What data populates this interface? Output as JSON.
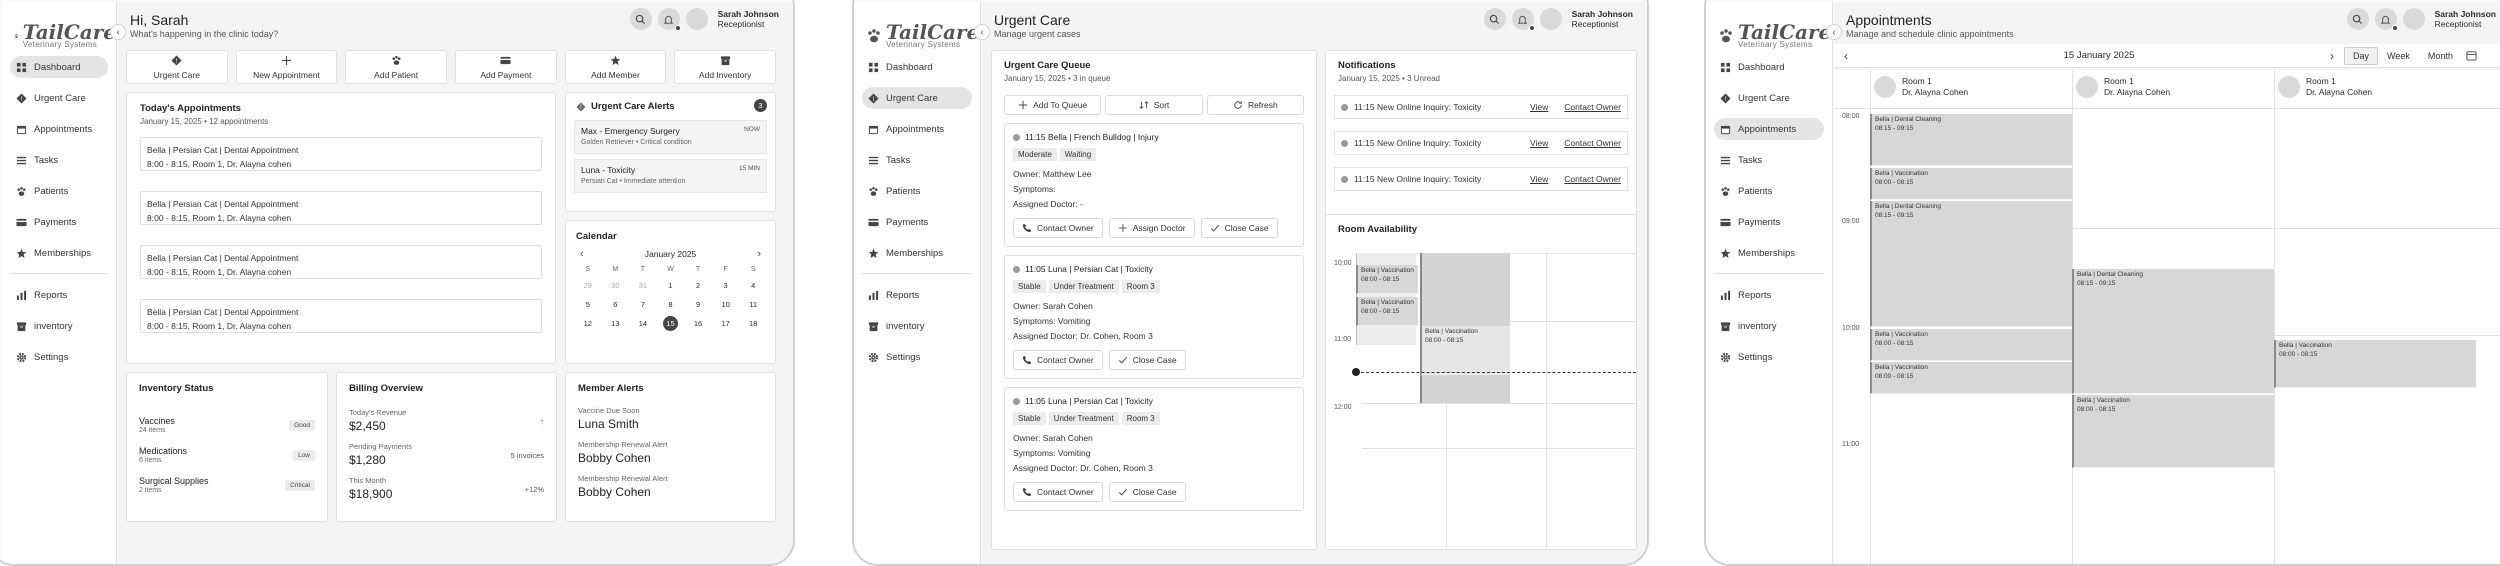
{
  "brand": {
    "name": "TailCare",
    "tagline": "Veterinary Systems"
  },
  "user": {
    "name": "Sarah Johnson",
    "role": "Receptionist"
  },
  "nav": [
    {
      "label": "Dashboard",
      "icon": "grid-icon"
    },
    {
      "label": "Urgent Care",
      "icon": "diamond-alert-icon"
    },
    {
      "label": "Appointments",
      "icon": "calendar-icon"
    },
    {
      "label": "Tasks",
      "icon": "list-icon"
    },
    {
      "label": "Patients",
      "icon": "paw-icon"
    },
    {
      "label": "Payments",
      "icon": "card-icon"
    },
    {
      "label": "Memberships",
      "icon": "star-icon"
    },
    {
      "label": "Reports",
      "icon": "bar-chart-icon"
    },
    {
      "label": "inventory",
      "icon": "box-icon"
    },
    {
      "label": "Settings",
      "icon": "gear-icon"
    }
  ],
  "dashboard": {
    "title": "Hi, Sarah",
    "subtitle": "What's happening in the clinic today?",
    "quick_actions": [
      "Urgent Care",
      "New Appointment",
      "Add Patient",
      "Add Payment",
      "Add Member",
      "Add Inventory"
    ],
    "today": {
      "title": "Today's Appointments",
      "subtitle": "January 15, 2025 • 12 appointments",
      "items": [
        {
          "line1": "Bella | Persian Cat | Dental Appointment",
          "line2": "8:00 - 8:15, Room 1, Dr. Alayna cohen"
        },
        {
          "line1": "Bella | Persian Cat | Dental Appointment",
          "line2": "8:00 - 8:15, Room 1, Dr. Alayna cohen"
        },
        {
          "line1": "Bella | Persian Cat | Dental Appointment",
          "line2": "8:00 - 8:15, Room 1, Dr. Alayna cohen"
        },
        {
          "line1": "Bella | Persian Cat | Dental Appointment",
          "line2": "8:00 - 8:15, Room 1, Dr. Alayna cohen"
        }
      ]
    },
    "alerts": {
      "title": "Urgent Care Alerts",
      "count": "3",
      "items": [
        {
          "title": "Max - Emergency Surgery",
          "detail": "Golden Retriever • Critical condition",
          "tag": "NOW"
        },
        {
          "title": "Luna - Toxicity",
          "detail": "Persian Cat • Immediate attention",
          "tag": "15 MIN"
        }
      ]
    },
    "calendar": {
      "title": "Calendar",
      "month": "January 2025",
      "days": [
        "S",
        "M",
        "T",
        "W",
        "T",
        "F",
        "S"
      ],
      "cells": [
        [
          "29",
          1
        ],
        [
          "30",
          1
        ],
        [
          "31",
          1
        ],
        [
          "1",
          0
        ],
        [
          "2",
          0
        ],
        [
          "3",
          0
        ],
        [
          "4",
          0
        ],
        [
          "5",
          0
        ],
        [
          "6",
          0
        ],
        [
          "7",
          0
        ],
        [
          "8",
          0
        ],
        [
          "9",
          0
        ],
        [
          "10",
          0
        ],
        [
          "11",
          0
        ],
        [
          "12",
          0
        ],
        [
          "13",
          0
        ],
        [
          "14",
          0
        ],
        [
          "15",
          2
        ],
        [
          "16",
          0
        ],
        [
          "17",
          0
        ],
        [
          "18",
          0
        ]
      ]
    },
    "inventory": {
      "title": "Inventory Status",
      "items": [
        {
          "name": "Vaccines",
          "count": "24 items",
          "status": "Good"
        },
        {
          "name": "Medications",
          "count": "6 items",
          "status": "Low"
        },
        {
          "name": "Surgical Supplies",
          "count": "2 items",
          "status": "Critical"
        }
      ]
    },
    "billing": {
      "title": "Billing Overview",
      "items": [
        {
          "label": "Today's Revenue",
          "value": "$2,450",
          "right": "↑"
        },
        {
          "label": "Pending Payments",
          "value": "$1,280",
          "right": "5 invoices"
        },
        {
          "label": "This Month",
          "value": "$18,900",
          "right": "+12%"
        }
      ]
    },
    "member_alerts": {
      "title": "Member Alerts",
      "items": [
        {
          "label": "Vaccine Due Soon",
          "value": "Luna Smith"
        },
        {
          "label": "Membership Renewal Alert",
          "value": "Bobby Cohen"
        },
        {
          "label": "Membership Renewal Alert",
          "value": "Bobby Cohen"
        }
      ]
    }
  },
  "urgent": {
    "title": "Urgent Care",
    "subtitle": "Manage urgent cases",
    "queue": {
      "title": "Urgent Care Queue",
      "subtitle": "January 15, 2025 • 3 in queue",
      "buttons": [
        "Add To Queue",
        "Sort",
        "Refresh"
      ],
      "cases": [
        {
          "head": "11:15 Bella | French Bulldog | Injury",
          "pills": [
            "Moderate",
            "Waiting"
          ],
          "owner": "Owner: Matthew Lee",
          "symptoms": "Symptoms:",
          "doctor": "Assigned Doctor: -",
          "actions": [
            "Contact Owner",
            "Assign Doctor",
            "Close Case"
          ]
        },
        {
          "head": "11:05 Luna | Persian Cat | Toxicity",
          "pills": [
            "Stable",
            "Under Treatment",
            "Room 3"
          ],
          "owner": "Owner: Sarah Cohen",
          "symptoms": "Symptoms: Vomiting",
          "doctor": "Assigned Doctor: Dr. Cohen, Room 3",
          "actions": [
            "Contact Owner",
            "Close Case"
          ]
        },
        {
          "head": "11:05 Luna | Persian Cat | Toxicity",
          "pills": [
            "Stable",
            "Under Treatment",
            "Room 3"
          ],
          "owner": "Owner: Sarah Cohen",
          "symptoms": "Symptoms: Vomiting",
          "doctor": "Assigned Doctor: Dr. Cohen, Room 3",
          "actions": [
            "Contact Owner",
            "Close Case"
          ]
        }
      ]
    },
    "notifications": {
      "title": "Notifications",
      "subtitle": "January 15, 2025 • 3 Unread",
      "items": [
        {
          "text": "11:15 New Online Inquiry: Toxicity",
          "view": "View",
          "contact": "Contact Owner"
        },
        {
          "text": "11:15 New Online Inquiry: Toxicity",
          "view": "View",
          "contact": "Contact Owner"
        },
        {
          "text": "11:15 New Online Inquiry: Toxicity",
          "view": "View",
          "contact": "Contact Owner"
        }
      ]
    },
    "room_availability": {
      "title": "Room Availability",
      "times": [
        "10:00",
        "11:00",
        "12:00"
      ],
      "events": [
        {
          "t": "Bella | Vaccination",
          "d": "08:00 - 08:15"
        },
        {
          "t": "Bella | Vaccination",
          "d": "08:00 - 08:15"
        },
        {
          "t": "Bella | Vaccination",
          "d": "08:00 - 08:15"
        }
      ]
    }
  },
  "appointments": {
    "title": "Appointments",
    "subtitle": "Manage and schedule clinic appointments",
    "date": "15 January 2025",
    "views": [
      "Day",
      "Week",
      "Month"
    ],
    "rooms": [
      {
        "room": "Room 1",
        "doctor": "Dr. Alayna Cohen"
      },
      {
        "room": "Room 1",
        "doctor": "Dr. Alayna Cohen"
      },
      {
        "room": "Room 1",
        "doctor": "Dr. Alayna Cohen"
      }
    ],
    "times": [
      "08:00",
      "09:00",
      "10:00",
      "11:00"
    ],
    "events": [
      {
        "t": "Bella | Dental Cleaning",
        "d": "08:15 - 09:15"
      },
      {
        "t": "Bella | Vaccination",
        "d": "08:00 - 08:15"
      },
      {
        "t": "Bella | Dental Cleaning",
        "d": "08:15 - 09:15"
      },
      {
        "t": "Bella | Vaccination",
        "d": "08:00 - 08:15"
      },
      {
        "t": "Bella | Vaccination",
        "d": "08:00 - 08:15"
      },
      {
        "t": "Bella | Dental Cleaning",
        "d": "08:15 - 09:15"
      },
      {
        "t": "Bella | Vaccination",
        "d": "08:00 - 08:15"
      },
      {
        "t": "Bella | Vaccination",
        "d": "08:00 - 08:15"
      }
    ]
  }
}
